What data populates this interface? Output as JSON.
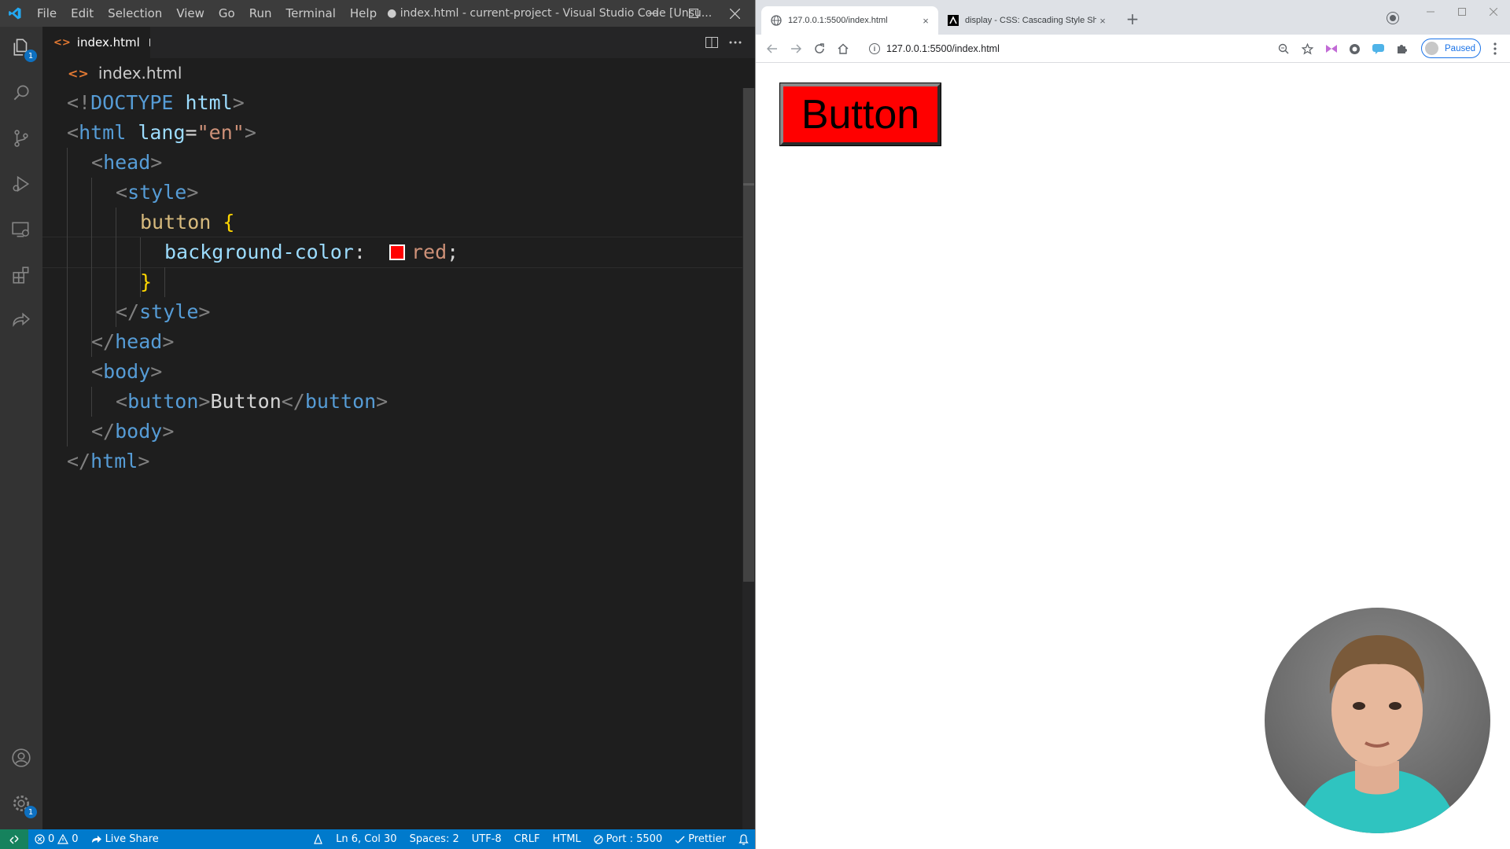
{
  "vscode": {
    "menu": [
      "File",
      "Edit",
      "Selection",
      "View",
      "Go",
      "Run",
      "Terminal",
      "Help"
    ],
    "window_title": "● index.html - current-project - Visual Studio Code [Unsu...",
    "tab": {
      "label": "index.html",
      "icon": "<>"
    },
    "breadcrumb": {
      "icon": "<>",
      "label": "index.html"
    },
    "activity_badges": {
      "explorer": "1",
      "settings": "1"
    },
    "code": {
      "l1": {
        "open": "<!",
        "kw": "DOCTYPE",
        "name": " html",
        "close": ">"
      },
      "l2": {
        "open": "<",
        "tag": "html",
        "attr": " lang",
        "eq": "=",
        "val": "\"en\"",
        "close": ">"
      },
      "l3": {
        "open": "<",
        "tag": "head",
        "close": ">"
      },
      "l4": {
        "open": "<",
        "tag": "style",
        "close": ">"
      },
      "l5": {
        "sel": "button",
        "brace": " {"
      },
      "l6": {
        "prop": "background-color",
        "colon": ":",
        "val": "red",
        "semi": ";"
      },
      "l7": {
        "brace": "}"
      },
      "l8": {
        "open": "</",
        "tag": "style",
        "close": ">"
      },
      "l9": {
        "open": "</",
        "tag": "head",
        "close": ">"
      },
      "l10": {
        "open": "<",
        "tag": "body",
        "close": ">"
      },
      "l11": {
        "open": "<",
        "tag": "button",
        "close": ">",
        "text": "Button",
        "open2": "</",
        "tag2": "button",
        "close2": ">"
      },
      "l12": {
        "open": "</",
        "tag": "body",
        "close": ">"
      },
      "l13": {
        "open": "</",
        "tag": "html",
        "close": ">"
      }
    },
    "statusbar": {
      "errors": "0",
      "warnings": "0",
      "live_share": "Live Share",
      "position": "Ln 6, Col 30",
      "spaces": "Spaces: 2",
      "encoding": "UTF-8",
      "eol": "CRLF",
      "language": "HTML",
      "port": "Port : 5500",
      "prettier": "Prettier"
    }
  },
  "chrome": {
    "tabs": [
      {
        "title": "127.0.0.1:5500/index.html",
        "close": "×"
      },
      {
        "title": "display - CSS: Cascading Style Sh",
        "close": "×"
      }
    ],
    "new_tab": "+",
    "url": "127.0.0.1:5500/index.html",
    "paused_label": "Paused",
    "page": {
      "button_label": "Button",
      "button_color": "#ff0000"
    }
  },
  "colors": {
    "vscode_bg": "#1e1e1e",
    "status_bar": "#007acc",
    "accent": "#ff0000"
  }
}
